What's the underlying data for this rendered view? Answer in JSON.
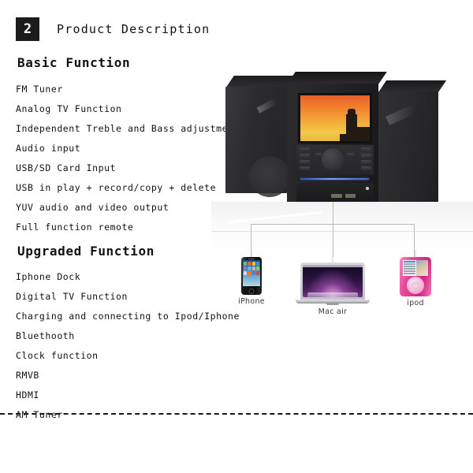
{
  "header": {
    "badge_number": "2",
    "title": "Product Description"
  },
  "sections": [
    {
      "title": "Basic Function",
      "items": [
        "FM Tuner",
        "Analog TV Function",
        "Independent Treble and Bass adjustment",
        "Audio input",
        "USB/SD Card Input",
        "USB in play + record/copy + delete",
        "YUV audio and video output",
        "Full function remote"
      ]
    },
    {
      "title": "Upgraded Function",
      "items": [
        "Iphone Dock",
        "Digital TV Function",
        "Charging and connecting to Ipod/Iphone",
        "Bluethooth",
        "Clock function",
        "RMVB",
        "HDMI",
        "AM Tuner"
      ]
    }
  ],
  "product": {
    "name": "micro-hi-fi-system",
    "screen_content": "sunset-tower-silhouette",
    "devices": [
      {
        "name": "iphone-device",
        "label": "iPhone"
      },
      {
        "name": "macbook-air-device",
        "label": "Mac air"
      },
      {
        "name": "ipod-nano-device",
        "label": "ipod"
      }
    ]
  },
  "colors": {
    "badge_background": "#1c1c1c",
    "badge_text": "#ffffff",
    "text": "#111111",
    "divider": "#1a1a1a",
    "connector_line": "#b9b9b9",
    "screen_sky": "#f0932c",
    "ipod_body": "#e8479c",
    "cd_slot_glow": "#5c82dd"
  }
}
